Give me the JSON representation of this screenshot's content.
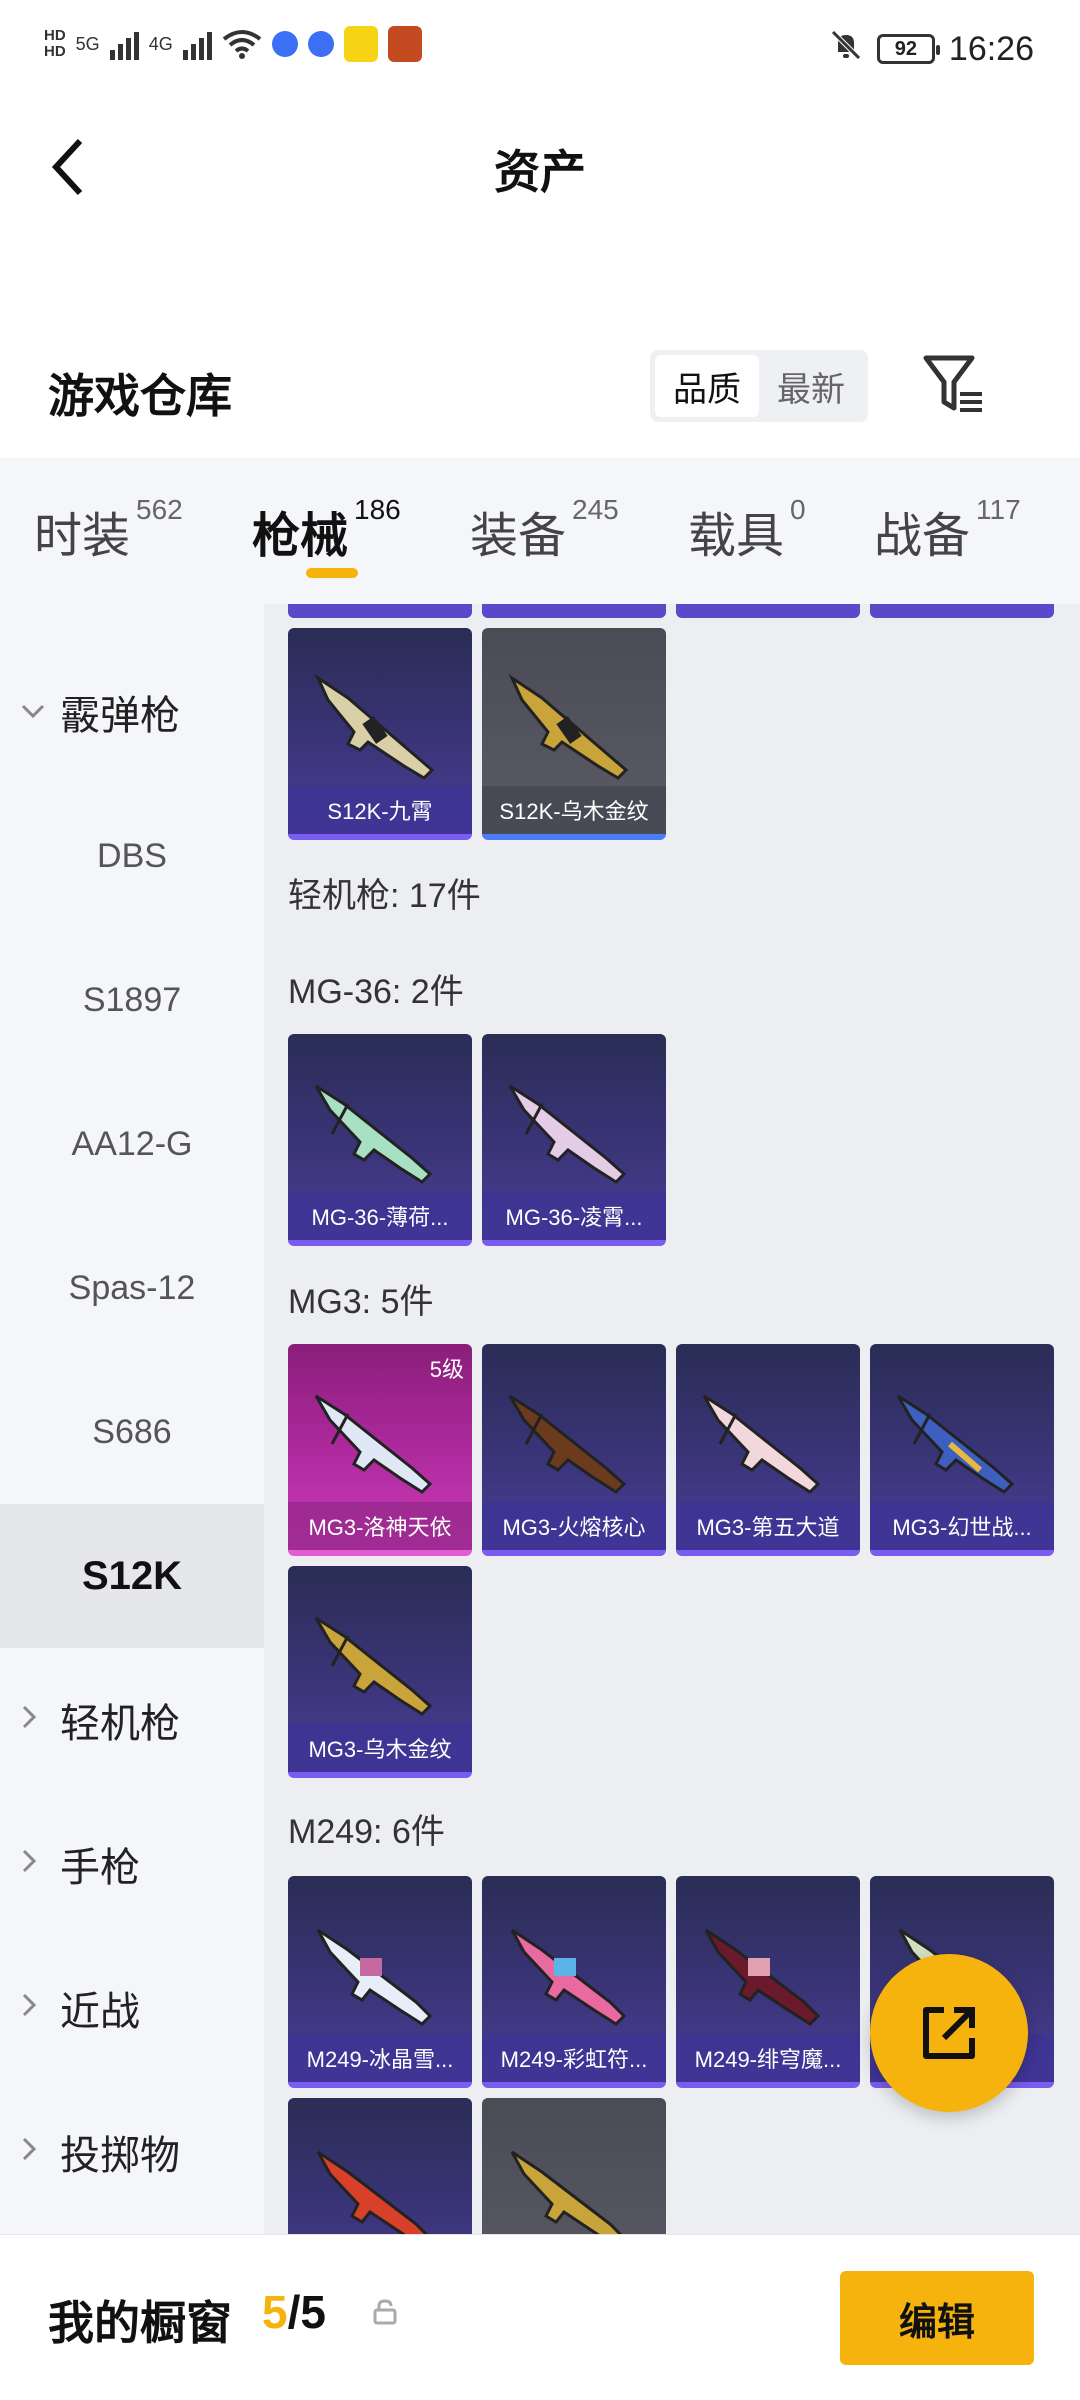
{
  "status_bar": {
    "network_left": "HD",
    "net_5g": "5G",
    "net_4g": "4G",
    "battery": "92",
    "time": "16:26"
  },
  "header": {
    "title": "资产"
  },
  "warehouse": {
    "title": "游戏仓库",
    "sort_options": [
      "品质",
      "最新"
    ],
    "sort_active": "品质"
  },
  "tabs": [
    {
      "label": "时装",
      "count": "562"
    },
    {
      "label": "枪械",
      "count": "186"
    },
    {
      "label": "装备",
      "count": "245"
    },
    {
      "label": "载具",
      "count": "0"
    },
    {
      "label": "战备",
      "count": "117"
    }
  ],
  "sidebar": {
    "group_shotgun": "霰弹枪",
    "sub_items": [
      "DBS",
      "S1897",
      "AA12-G",
      "Spas-12",
      "S686",
      "S12K"
    ],
    "selected": "S12K",
    "groups": [
      "轻机枪",
      "手枪",
      "近战",
      "投掷物"
    ]
  },
  "content": {
    "s12k_cards": [
      "S12K-九霄",
      "S12K-乌木金纹"
    ],
    "lmg_summary": "轻机枪: 17件",
    "mg36_label": "MG-36: 2件",
    "mg36_cards": [
      "MG-36-薄荷...",
      "MG-36-凌霄..."
    ],
    "mg3_label": "MG3: 5件",
    "mg3_cards": [
      "MG3-洛神天依",
      "MG3-火熔核心",
      "MG3-第五大道",
      "MG3-幻世战...",
      "MG3-乌木金纹"
    ],
    "mg3_badge": "5级",
    "m249_label": "M249: 6件",
    "m249_cards": [
      "M249-冰晶雪...",
      "M249-彩虹符...",
      "M249-绯穹魔...",
      "..."
    ]
  },
  "bottom_bar": {
    "label": "我的橱窗",
    "count_current": "5",
    "count_sep": "/5",
    "edit_label": "编辑"
  },
  "colors": {
    "accent": "#f7b30d",
    "card_purple": "#3a3478",
    "card_pink": "#b02aa0",
    "card_grey": "#5a5b66"
  }
}
